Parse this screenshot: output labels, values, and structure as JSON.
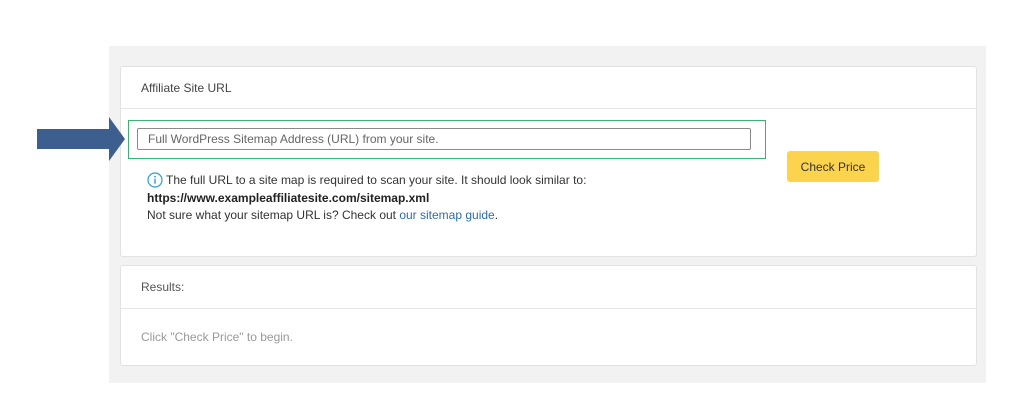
{
  "site_url_card": {
    "header": "Affiliate Site URL",
    "input_placeholder": "Full WordPress Sitemap Address (URL) from your site.",
    "input_value": "",
    "check_button_label": "Check Price",
    "info_text": "The full URL to a site map is required to scan your site. It should look similar to:",
    "example_url": "https://www.exampleaffiliatesite.com/sitemap.xml",
    "guide_prefix": "Not sure what your sitemap URL is? Check out ",
    "guide_link_text": "our sitemap guide",
    "guide_suffix": "."
  },
  "results_card": {
    "header": "Results:",
    "message": "Click \"Check Price\" to begin."
  },
  "colors": {
    "arrow": "#3d5f8f",
    "highlight_border": "#3cb371",
    "button_bg": "#fcd34d",
    "info_icon": "#2b9fd6",
    "link": "#2b6cb0"
  },
  "icons": {
    "arrow": "right-arrow-icon",
    "info": "info-icon"
  }
}
